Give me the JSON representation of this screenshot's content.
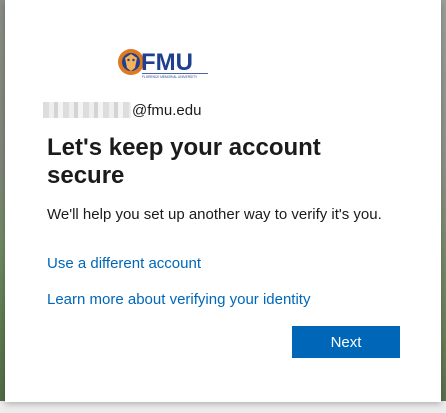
{
  "brand": {
    "logo_text": "FMU",
    "logo_subtext": "FLORENCE MEMORIAL UNIVERSITY",
    "primary_color": "#1f3f8f",
    "accent_color": "#e07a1f"
  },
  "identity": {
    "email_suffix": "@fmu.edu"
  },
  "main": {
    "title": "Let's keep your account secure",
    "description": "We'll help you set up another way to verify it's you.",
    "link_different_account": "Use a different account",
    "link_learn_more": "Learn more about verifying your identity",
    "next_label": "Next"
  },
  "colors": {
    "link": "#0067b8",
    "button": "#0067b8"
  }
}
